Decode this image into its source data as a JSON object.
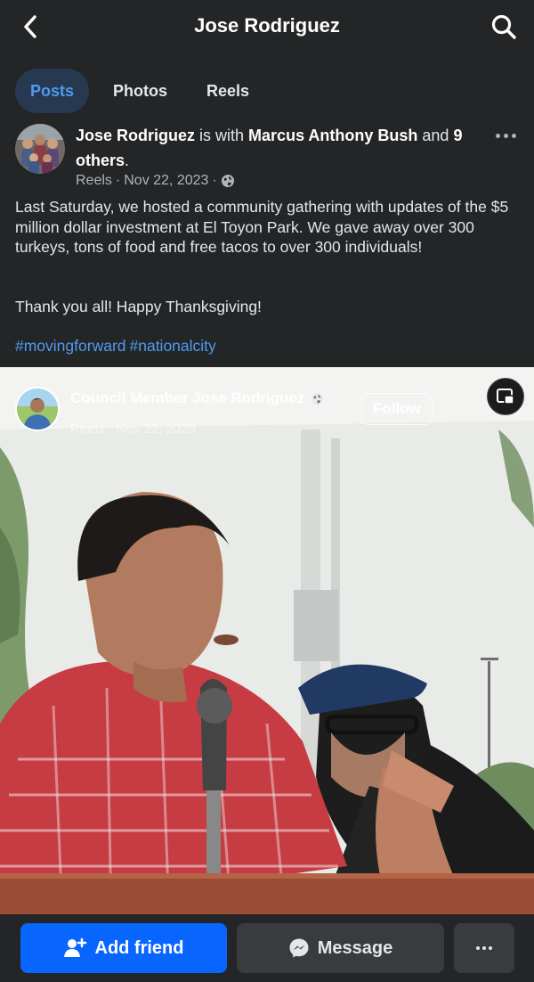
{
  "header": {
    "title": "Jose Rodriguez",
    "back_icon": "chevron-left-icon",
    "search_icon": "search-icon"
  },
  "tabs": [
    {
      "label": "Posts",
      "active": true
    },
    {
      "label": "Photos",
      "active": false
    },
    {
      "label": "Reels",
      "active": false
    }
  ],
  "post": {
    "author": "Jose Rodriguez",
    "with_text": " is with ",
    "tagged": "Marcus Anthony Bush",
    "and_text": " and ",
    "others": "9 others",
    "period": ".",
    "meta_source": "Reels",
    "meta_sep": "·",
    "date": "Nov 22, 2023",
    "privacy_icon": "globe-icon",
    "text": "Last Saturday, we hosted a community gathering with updates of the $5 million dollar investment at El Toyon Park. We gave away over 300 turkeys, tons of food and free tacos to over 300 individuals!",
    "text2": "Thank you all! Happy Thanksgiving!",
    "hashtags": [
      "#movingforward",
      "#nationalcity"
    ]
  },
  "video": {
    "page_name": "Council Member Jose Rodriguez",
    "subtitle": "Reels · Nov 22, 2023",
    "follow_label": "Follow",
    "pip_icon": "picture-in-picture-icon"
  },
  "actions": {
    "add_friend": "Add friend",
    "message": "Message",
    "more_icon": "more-icon"
  },
  "colors": {
    "background": "#242526",
    "accent": "#0866ff",
    "link": "#4e9bf0",
    "active_tab_bg": "#263951",
    "secondary_button": "#3a3b3c"
  }
}
